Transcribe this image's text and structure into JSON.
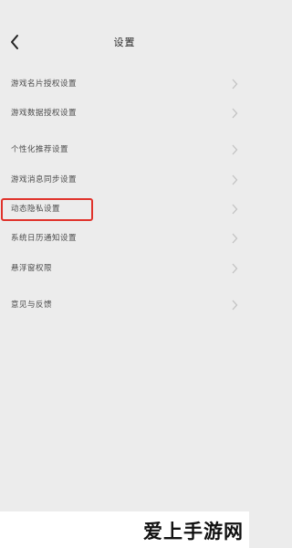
{
  "header": {
    "title": "设置",
    "back_icon": "chevron-left-icon"
  },
  "settings": {
    "items": [
      {
        "label": "游戏名片授权设置"
      },
      {
        "label": "游戏数据授权设置"
      },
      {
        "label": "个性化推荐设置"
      },
      {
        "label": "游戏消息同步设置"
      },
      {
        "label": "动态隐私设置"
      },
      {
        "label": "系统日历通知设置"
      },
      {
        "label": "悬浮窗权限"
      },
      {
        "label": "意见与反馈"
      }
    ],
    "highlighted_item": "动态隐私设置",
    "highlight_color": "#e0322b"
  },
  "watermark": {
    "text": "爱上手游网"
  }
}
